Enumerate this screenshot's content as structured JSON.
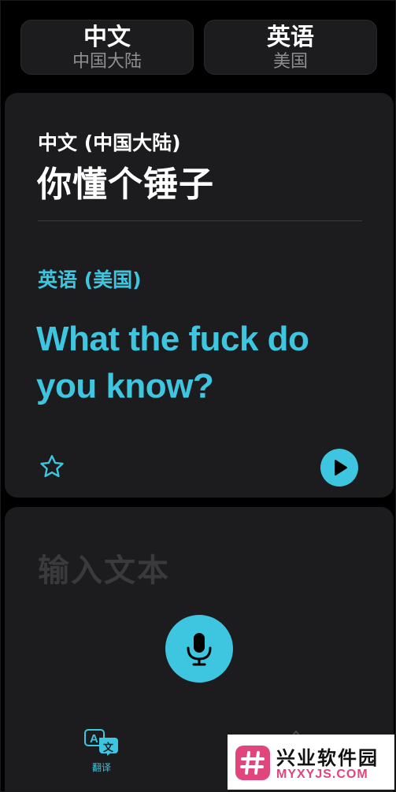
{
  "language_selector": {
    "source": {
      "name": "中文",
      "region": "中国大陆"
    },
    "target": {
      "name": "英语",
      "region": "美国"
    }
  },
  "translation_card": {
    "source_language": "中文 (中国大陆)",
    "source_text": "你懂个锤子",
    "target_language": "英语 (美国)",
    "target_text": "What the fuck do you know?",
    "favorite_icon": "star-outline-icon",
    "play_icon": "play-icon"
  },
  "input_panel": {
    "placeholder": "输入文本",
    "mic_icon": "microphone-icon"
  },
  "tab_bar": {
    "translate_label": "翻译",
    "translate_icon": "translate-icon"
  },
  "watermark": {
    "title": "兴业软件园",
    "url": "MYXYJS.COM"
  },
  "colors": {
    "accent": "#3ec6e0",
    "background": "#000000",
    "card": "#1c1c1e",
    "secondary_text": "#8e8e93",
    "placeholder": "#3a3a3c",
    "watermark_brand": "#e0457b"
  }
}
